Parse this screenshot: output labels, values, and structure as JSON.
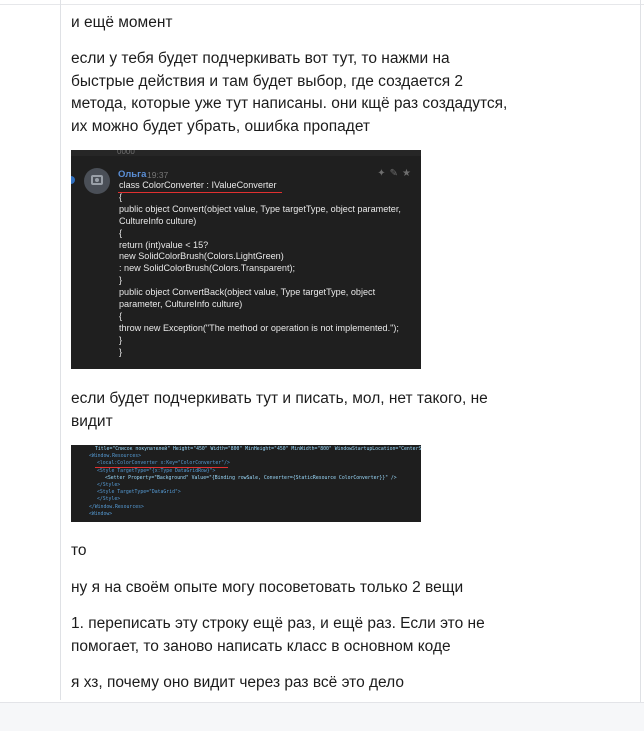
{
  "messages": {
    "m1": "и ещё момент",
    "m2_l1": "если у тебя будет подчеркивать вот тут, то нажми на",
    "m2_l2": "быстрые действия и там будет выбор, где создается 2",
    "m2_l3": "метода, которые уже тут написаны. они кщё раз создадутся,",
    "m2_l4": "их можно будет убрать, ошибка пропадет",
    "m3_l1": "если будет подчеркивать тут и писать, мол, нет такого, не",
    "m3_l2": "видит",
    "m4": "то",
    "m5": "ну я на своём опыте могу посоветовать только 2 вещи",
    "m6_l1": "1. переписать эту строку ещё раз, и ещё раз. Если это не",
    "m6_l2": "помогает, то заново написать класс в основном коде",
    "m7": "я хз, почему оно видит через раз всё это дело"
  },
  "screenshot1": {
    "top_word": "0000",
    "author": "Ольга",
    "time": "19:37",
    "icons": [
      "pin-icon",
      "edit-icon",
      "star-icon"
    ],
    "code_lines": [
      "class ColorConverter : IValueConverter",
      "{",
      "public object Convert(object value, Type targetType, object parameter,",
      "CultureInfo culture)",
      "{",
      "return (int)value < 15?",
      "new SolidColorBrush(Colors.LightGreen)",
      ": new SolidColorBrush(Colors.Transparent);",
      "}",
      "public object ConvertBack(object value, Type targetType, object",
      "parameter, CultureInfo culture)",
      "{",
      "throw new Exception(\"The method or operation is not implemented.\");",
      "}",
      "}"
    ]
  },
  "screenshot2": {
    "code_lines": [
      "Title=\"Список покупателей\" Height=\"450\" Width=\"800\" MinHeight=\"450\" MinWidth=\"800\" WindowStartupLocation=\"CenterScreen\">",
      "<Window.Resources>",
      "<local:ColorConverter x:Key=\"ColorConverter\"/>",
      "<Style TargetType=\"{x:Type DataGridRow}\">",
      "<Setter Property=\"Background\" Value=\"{Binding rowSale, Converter={StaticResource ColorConverter}}\" />",
      "</Style>",
      "<Style TargetType=\"DataGrid\">",
      "</Style>",
      "</Window.Resources>",
      "<Window>"
    ]
  },
  "colors": {
    "text": "#1c1c1c",
    "underline": "#e03030",
    "author_link": "#5b8fd6"
  }
}
